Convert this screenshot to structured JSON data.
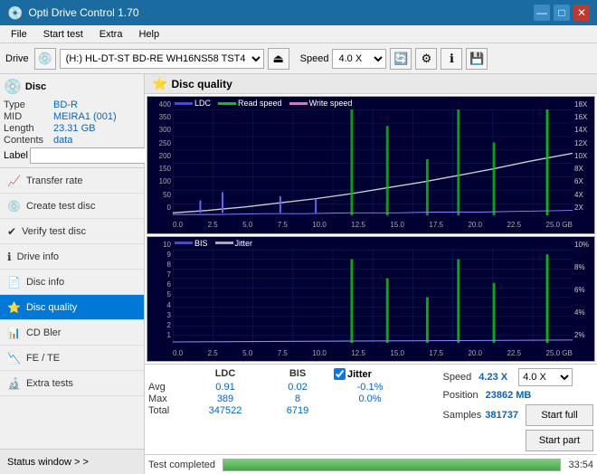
{
  "app": {
    "title": "Opti Drive Control 1.70",
    "icon": "💿"
  },
  "title_buttons": {
    "minimize": "—",
    "maximize": "□",
    "close": "✕"
  },
  "menu": {
    "items": [
      "File",
      "Start test",
      "Extra",
      "Help"
    ]
  },
  "toolbar": {
    "drive_label": "Drive",
    "drive_value": "(H:) HL-DT-ST BD-RE  WH16NS58 TST4",
    "speed_label": "Speed",
    "speed_value": "4.0 X"
  },
  "disc": {
    "title": "Disc",
    "type_label": "Type",
    "type_value": "BD-R",
    "mid_label": "MID",
    "mid_value": "MEIRA1 (001)",
    "length_label": "Length",
    "length_value": "23.31 GB",
    "contents_label": "Contents",
    "contents_value": "data",
    "label_label": "Label"
  },
  "nav": {
    "items": [
      {
        "id": "transfer-rate",
        "label": "Transfer rate",
        "icon": "📈"
      },
      {
        "id": "create-test-disc",
        "label": "Create test disc",
        "icon": "💿"
      },
      {
        "id": "verify-test-disc",
        "label": "Verify test disc",
        "icon": "✔"
      },
      {
        "id": "drive-info",
        "label": "Drive info",
        "icon": "ℹ"
      },
      {
        "id": "disc-info",
        "label": "Disc info",
        "icon": "📄"
      },
      {
        "id": "disc-quality",
        "label": "Disc quality",
        "icon": "⭐",
        "active": true
      },
      {
        "id": "cd-bler",
        "label": "CD Bler",
        "icon": "📊"
      },
      {
        "id": "fe-te",
        "label": "FE / TE",
        "icon": "📉"
      },
      {
        "id": "extra-tests",
        "label": "Extra tests",
        "icon": "🔬"
      }
    ],
    "status_window": "Status window > >"
  },
  "disc_quality": {
    "title": "Disc quality",
    "chart1": {
      "legend": [
        {
          "key": "ldc",
          "label": "LDC"
        },
        {
          "key": "read",
          "label": "Read speed"
        },
        {
          "key": "write",
          "label": "Write speed"
        }
      ],
      "y_left": [
        "400",
        "350",
        "300",
        "250",
        "200",
        "150",
        "100",
        "50",
        "0"
      ],
      "y_right": [
        "18X",
        "16X",
        "14X",
        "12X",
        "10X",
        "8X",
        "6X",
        "4X",
        "2X"
      ],
      "x_labels": [
        "0.0",
        "2.5",
        "5.0",
        "7.5",
        "10.0",
        "12.5",
        "15.0",
        "17.5",
        "20.0",
        "22.5",
        "25.0 GB"
      ]
    },
    "chart2": {
      "legend": [
        {
          "key": "bis",
          "label": "BIS"
        },
        {
          "key": "jitter",
          "label": "Jitter"
        }
      ],
      "y_left": [
        "10",
        "9",
        "8",
        "7",
        "6",
        "5",
        "4",
        "3",
        "2",
        "1"
      ],
      "y_right": [
        "10%",
        "8%",
        "6%",
        "4%",
        "2%"
      ],
      "x_labels": [
        "0.0",
        "2.5",
        "5.0",
        "7.5",
        "10.0",
        "12.5",
        "15.0",
        "17.5",
        "20.0",
        "22.5",
        "25.0 GB"
      ]
    }
  },
  "stats": {
    "columns": [
      "LDC",
      "BIS",
      "",
      "Jitter"
    ],
    "rows": [
      {
        "label": "Avg",
        "ldc": "0.91",
        "bis": "0.02",
        "jitter": "-0.1%"
      },
      {
        "label": "Max",
        "ldc": "389",
        "bis": "8",
        "jitter": "0.0%"
      },
      {
        "label": "Total",
        "ldc": "347522",
        "bis": "6719",
        "jitter": ""
      }
    ],
    "jitter_checked": true,
    "speed_label": "Speed",
    "speed_value": "4.23 X",
    "speed_select": "4.0 X",
    "position_label": "Position",
    "position_value": "23862 MB",
    "samples_label": "Samples",
    "samples_value": "381737",
    "btn_start_full": "Start full",
    "btn_start_part": "Start part"
  },
  "progress": {
    "status": "Test completed",
    "percent": 100,
    "time": "33:54"
  }
}
